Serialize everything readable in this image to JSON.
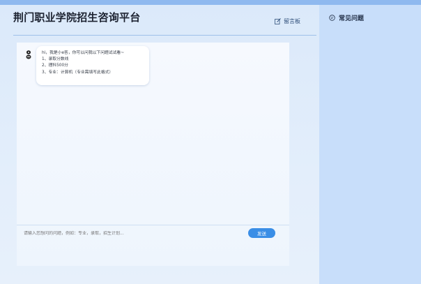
{
  "header": {
    "title": "荆门职业学院招生咨询平台",
    "guestbook_label": "留言板"
  },
  "chat": {
    "bot_message": {
      "greeting": "hi，我是小e答，你可以问我以下问题试试看~",
      "line1": "1、录取分数线",
      "line2": "2、理科500分",
      "line3": "3、专业：计算机（专业需填写此格式）"
    },
    "input": {
      "placeholder": "请输入您想问的问题，例如：专业，录取，招生计划..."
    },
    "send_label": "发送"
  },
  "sidebar": {
    "faq_label": "常见问题"
  },
  "colors": {
    "accent": "#3a8ee6",
    "sidebar_bg": "#c8defa",
    "top_band": "#8fb9ef"
  },
  "icons": {
    "guestbook": "edit-icon",
    "faq": "chat-bubble-icon",
    "avatar": "robot-avatar-icon"
  }
}
